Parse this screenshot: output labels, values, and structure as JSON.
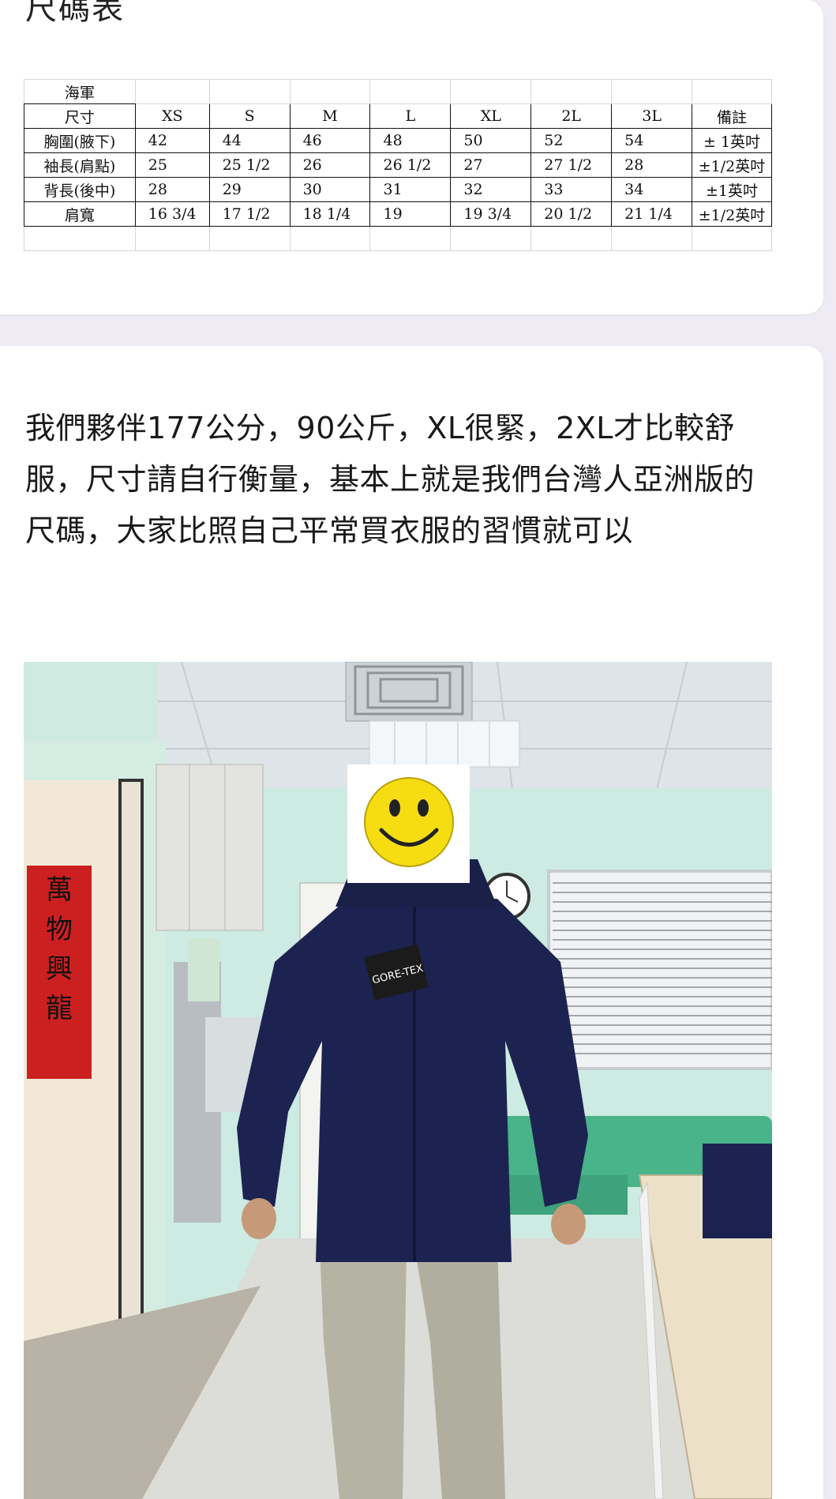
{
  "size_card": {
    "heading": "尺碼表",
    "table": {
      "group": "海軍",
      "header": [
        "尺寸",
        "XS",
        "S",
        "M",
        "L",
        "XL",
        "2L",
        "3L",
        "備註"
      ],
      "rows": [
        [
          "胸圍(腋下)",
          "42",
          "44",
          "46",
          "48",
          "50",
          "52",
          "54",
          "± 1英吋"
        ],
        [
          "袖長(肩點)",
          "25",
          "25 1/2",
          "26",
          "26 1/2",
          "27",
          "27 1/2",
          "28",
          "±1/2英吋"
        ],
        [
          "背長(後中)",
          "28",
          "29",
          "30",
          "31",
          "32",
          "33",
          "34",
          "±1英吋"
        ],
        [
          "肩寬",
          "16 3/4",
          "17 1/2",
          "18 1/4",
          "19",
          "19 3/4",
          "20 1/2",
          "21 1/4",
          "±1/2英吋"
        ]
      ]
    }
  },
  "post_card": {
    "text": "我們夥伴177公分，90公斤，XL很緊，2XL才比較舒服，尺寸請自行衡量，基本上就是我們台灣人亞洲版的尺碼，大家比照自己平常買衣服的習慣就可以",
    "photo": {
      "tag_text": "GORE-TEX",
      "banner_text": "萬物興龍"
    }
  },
  "colors": {
    "page_bg": "#eeebf4",
    "card_bg": "#ffffff",
    "jacket": "#1c2350",
    "wall": "#cfeae0"
  }
}
